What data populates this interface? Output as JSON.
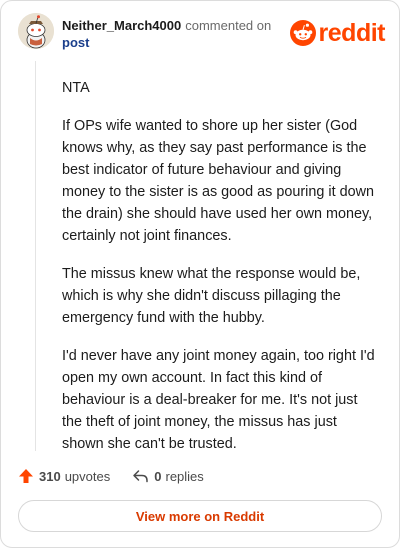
{
  "header": {
    "author": "Neither_March4000",
    "commented_text": "commented on",
    "post_link": "post",
    "logo_text": "reddit",
    "brand_color": "#ff4500"
  },
  "comment": {
    "paragraphs": [
      "NTA",
      "If OPs wife wanted to shore up her sister (God knows why, as they say past performance is the best indicator of future behaviour and giving money to the sister is as good as pouring it down the drain) she should have used her own money, certainly not joint finances.",
      "The missus knew what the response would be, which is why she didn't discuss pillaging the emergency fund with the hubby.",
      "I'd never have any joint money again, too right I'd open my own account. In fact this kind of behaviour is a deal-breaker for me. It's not just the theft of joint money, the missus has just shown she can't be trusted."
    ]
  },
  "actions": {
    "upvotes_count": "310",
    "upvotes_label": "upvotes",
    "upvote_icon": "upvote-arrow-icon",
    "replies_count": "0",
    "replies_label": "replies",
    "reply_icon": "reply-arrow-icon"
  },
  "footer": {
    "view_more_label": "View more on Reddit",
    "link_color": "#d93a00"
  }
}
